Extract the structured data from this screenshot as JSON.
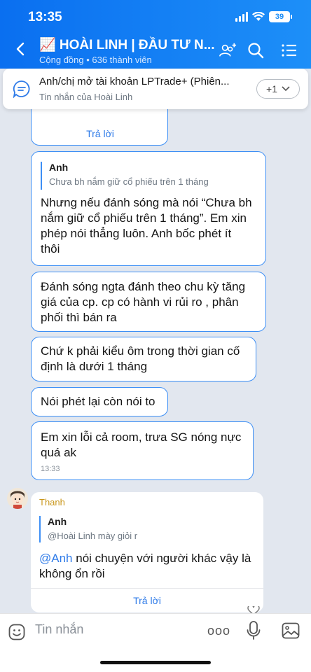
{
  "status_bar": {
    "time": "13:35",
    "battery": "39"
  },
  "header": {
    "title": "📈 HOÀI LINH | ĐẦU TƯ N...",
    "subtitle": "Cộng đồng • 636 thành viên"
  },
  "pinned": {
    "title": "Anh/chị mở tài khoản LPTrade+ (Phiên...",
    "subtitle": "Tin nhắn của Hoài Linh",
    "more": "+1"
  },
  "messages": {
    "reply_label": "Trả lời",
    "m1": {
      "quote_author": "Anh",
      "quote_text": "Chưa bh nắm giữ cổ phiếu trên 1 tháng",
      "lines": [
        "Nhưng nếu đánh sóng mà nói “Chưa bh",
        "nắm giữ cổ phiếu trên 1 tháng”. Em xin",
        "phép nói thẳng luôn. Anh bốc phét ít",
        "thôi"
      ]
    },
    "m2": {
      "lines": [
        "Đánh sóng ngta đánh theo chu kỳ tăng",
        "giá của cp. cp có hành vi rủi ro , phân",
        "phối thì bán ra"
      ]
    },
    "m3": {
      "lines": [
        "Chứ k phải kiểu ôm trong thời gian cố",
        "định là dưới 1 tháng"
      ]
    },
    "m4": {
      "lines": [
        "Nói phét lại còn nói to"
      ]
    },
    "m5": {
      "lines": [
        "Em xin lỗi cả room, trưa SG nóng nực",
        "quá ak"
      ],
      "time": "13:33"
    },
    "m6": {
      "sender": "Thanh",
      "quote_author": "Anh",
      "quote_text": "@Hoài Linh mày giỏi r",
      "mention": "@Anh",
      "line1_rest": " nói chuyện với người khác vậy là",
      "line2": "không ổn rồi"
    }
  },
  "composer": {
    "placeholder": "Tin nhắn",
    "more": "ooo"
  },
  "colors": {
    "header": "#1d8ff8",
    "bubble_border": "#3d8ff5",
    "link": "#2f7be8",
    "background": "#e2e7ef"
  }
}
